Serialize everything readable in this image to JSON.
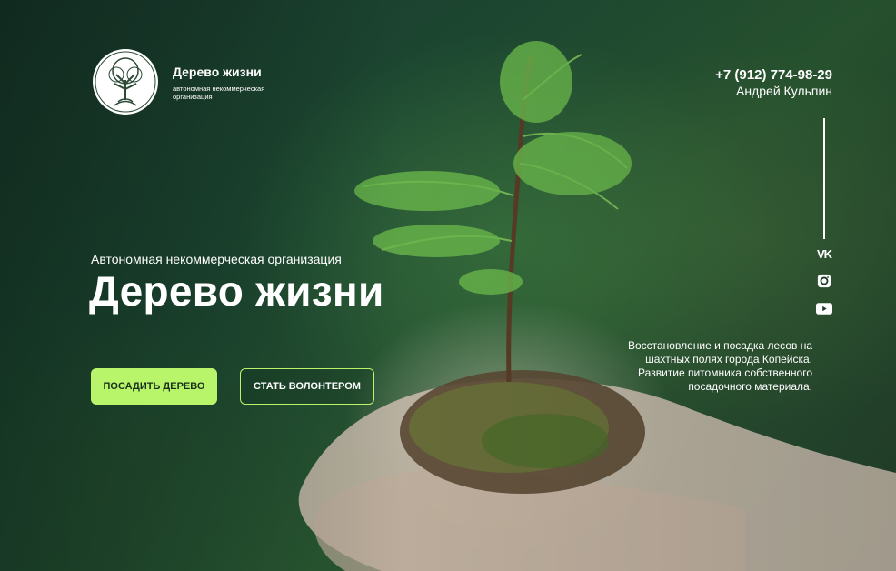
{
  "header": {
    "brand_name": "Дерево жизни",
    "brand_subtitle": "автономная некоммерческая организация",
    "phone": "+7 (912) 774-98-29",
    "contact_name": "Андрей Кульпин"
  },
  "social": {
    "icons": [
      "vk-icon",
      "instagram-icon",
      "youtube-icon"
    ],
    "vk_glyph": "VK"
  },
  "hero": {
    "org_label": "Автономная некоммерческая организация",
    "title": "Дерево жизни",
    "primary_button": "ПОСАДИТЬ ДЕРЕВО",
    "secondary_button": "СТАТЬ ВОЛОНТЕРОМ",
    "description": "Восстановление и посадка лесов на шахтных полях города Копейска. Развитие питомника собственного посадочного материала."
  },
  "colors": {
    "accent": "#b9f56b",
    "background": "#1e4a33",
    "text": "#ffffff"
  }
}
